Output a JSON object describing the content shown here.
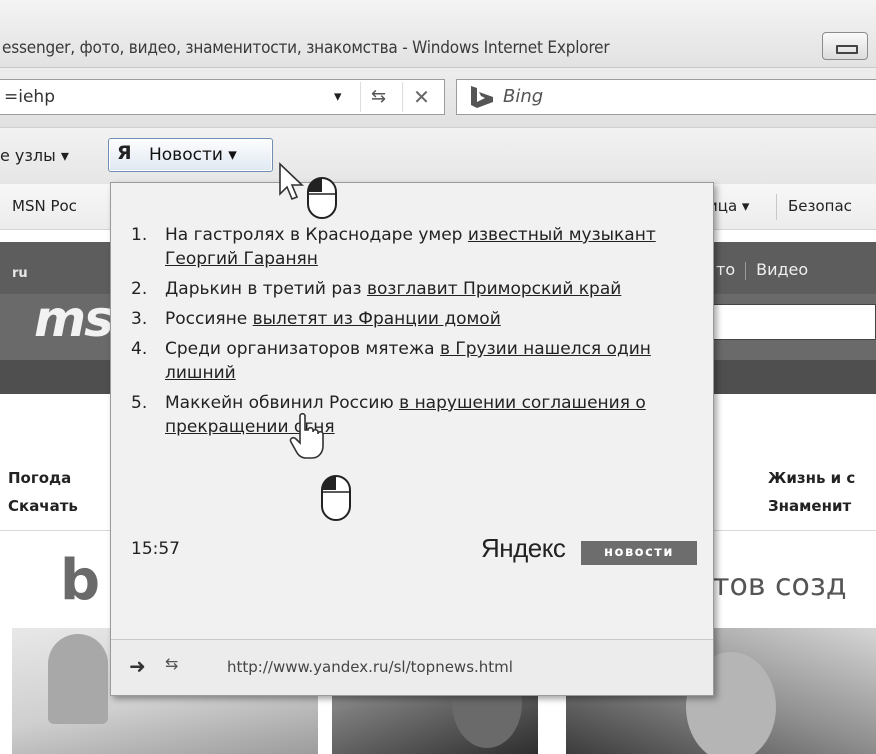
{
  "window": {
    "title": "essenger, фото, видео, знаменитости, знакомства - Windows Internet Explorer"
  },
  "address_bar": {
    "url_fragment": "=iehp"
  },
  "search_box": {
    "provider": "Bing"
  },
  "favorites_bar": {
    "sites_label": "е узлы ▾",
    "news_button_label": "Новости ▾",
    "news_button_mark": "Я"
  },
  "command_bar": {
    "msn_label": "MSN Рос",
    "page_label": "ица ▾",
    "safety_label": "Безопас"
  },
  "msn_page": {
    "logo_ru": "ru",
    "logo_text": "ms",
    "nav_left": "то",
    "nav_video": "Видео",
    "links_left": [
      "Погода",
      "Скачать"
    ],
    "links_right": [
      "Жизнь и с",
      "Знаменит"
    ],
    "tagline": "тов созд",
    "bing_b": "b"
  },
  "news_feed": {
    "items": [
      {
        "num": "1.",
        "text": "На гастролях в Краснодаре умер ",
        "link": "известный музыкант Георгий Гаранян"
      },
      {
        "num": "2.",
        "text": "Дарькин в третий раз ",
        "link": "возглавит Приморский край"
      },
      {
        "num": "3.",
        "text": "Россияне ",
        "link": "вылетят из Франции домой"
      },
      {
        "num": "4.",
        "text": "Среди организаторов мятежа ",
        "link": "в Грузии нашелся один лишний"
      },
      {
        "num": "5.",
        "text": "Маккейн обвинил Россию ",
        "link": "в нарушении соглашения о прекращении огня"
      }
    ],
    "time": "15:57",
    "brand": "Яндекс",
    "brand_badge": "новости",
    "feed_url": "http://www.yandex.ru/sl/topnews.html"
  },
  "icons": {
    "refresh": "refresh-icon",
    "stop": "stop-icon",
    "go": "go-arrow-icon",
    "bing": "bing-logo-icon"
  }
}
